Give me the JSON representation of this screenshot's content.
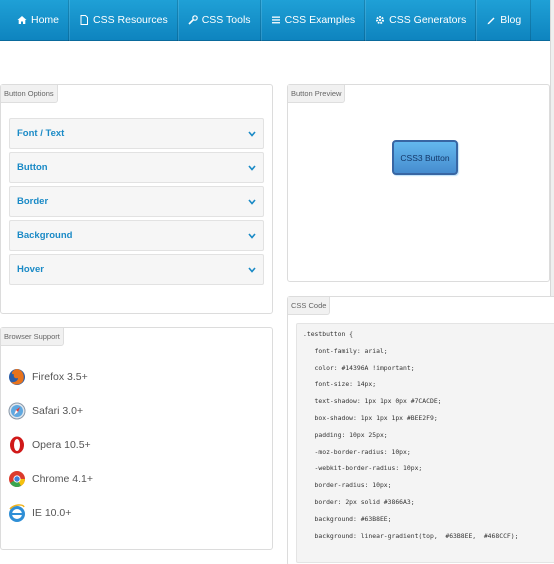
{
  "nav": {
    "items": [
      {
        "label": "Home",
        "icon": "home-icon"
      },
      {
        "label": "CSS Resources",
        "icon": "document-icon"
      },
      {
        "label": "CSS Tools",
        "icon": "wrench-icon"
      },
      {
        "label": "CSS Examples",
        "icon": "list-icon"
      },
      {
        "label": "CSS Generators",
        "icon": "gear-icon"
      },
      {
        "label": "Blog",
        "icon": "pencil-icon"
      }
    ]
  },
  "button_options": {
    "tag": "Button Options",
    "items": [
      "Font / Text",
      "Button",
      "Border",
      "Background",
      "Hover"
    ]
  },
  "button_preview": {
    "tag": "Button Preview",
    "button_label": "CSS3 Button"
  },
  "browser_support": {
    "tag": "Browser Support",
    "browsers": [
      {
        "name": "Firefox 3.5+",
        "icon": "firefox-icon"
      },
      {
        "name": "Safari 3.0+",
        "icon": "safari-icon"
      },
      {
        "name": "Opera 10.5+",
        "icon": "opera-icon"
      },
      {
        "name": "Chrome 4.1+",
        "icon": "chrome-icon"
      },
      {
        "name": "IE 10.0+",
        "icon": "ie-icon"
      }
    ]
  },
  "css_code": {
    "tag": "CSS Code",
    "lines": [
      ".testbutton {",
      "   font-family: arial;",
      "   color: #14396A !important;",
      "   font-size: 14px;",
      "   text-shadow: 1px 1px 0px #7CACDE;",
      "   box-shadow: 1px 1px 1px #BEE2F9;",
      "   padding: 10px 25px;",
      "   -moz-border-radius: 10px;",
      "   -webkit-border-radius: 10px;",
      "   border-radius: 10px;",
      "   border: 2px solid #3866A3;",
      "   background: #63B8EE;",
      "   background: linear-gradient(top,  #63B8EE,  #468CCF);"
    ]
  },
  "colors": {
    "nav": "#1796cf",
    "accent": "#1a8ac6",
    "button_top": "#63B8EE",
    "button_bottom": "#468CCF",
    "button_border": "#3866A3",
    "button_text": "#14396A"
  }
}
